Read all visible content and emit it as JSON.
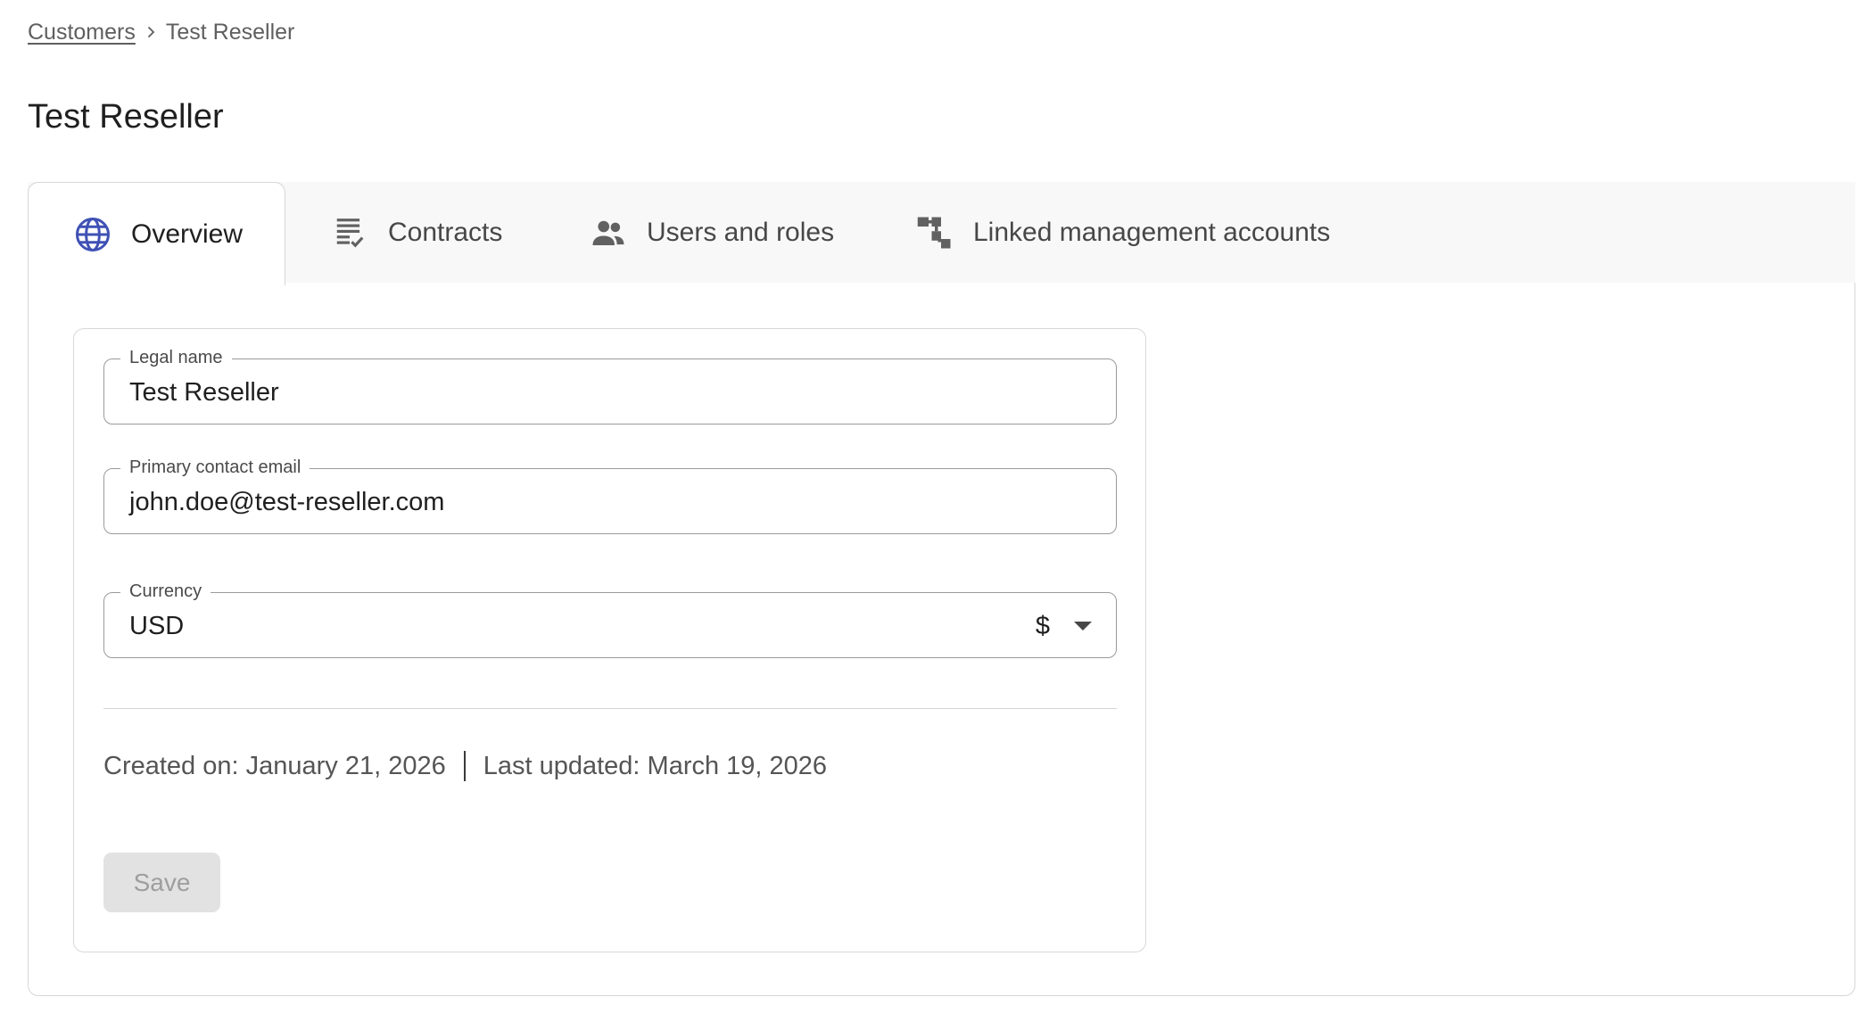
{
  "breadcrumb": {
    "parent": "Customers",
    "current": "Test Reseller"
  },
  "page": {
    "title": "Test Reseller"
  },
  "tabs": [
    {
      "label": "Overview",
      "icon": "globe-icon",
      "active": true
    },
    {
      "label": "Contracts",
      "icon": "checklist-icon",
      "active": false
    },
    {
      "label": "Users and roles",
      "icon": "people-icon",
      "active": false
    },
    {
      "label": "Linked management accounts",
      "icon": "account-tree-icon",
      "active": false
    }
  ],
  "form": {
    "legal_name": {
      "label": "Legal name",
      "value": "Test Reseller"
    },
    "email": {
      "label": "Primary contact email",
      "value": "john.doe@test-reseller.com"
    },
    "currency": {
      "label": "Currency",
      "value": "USD",
      "symbol": "$"
    }
  },
  "meta": {
    "created": "Created on: January 21, 2026",
    "updated": "Last updated: March 19, 2026"
  },
  "actions": {
    "save_label": "Save"
  },
  "colors": {
    "accent": "#3f51b5",
    "icon_gray": "#616161",
    "button_disabled_bg": "#e2e2e2",
    "button_disabled_text": "#9e9e9e"
  }
}
